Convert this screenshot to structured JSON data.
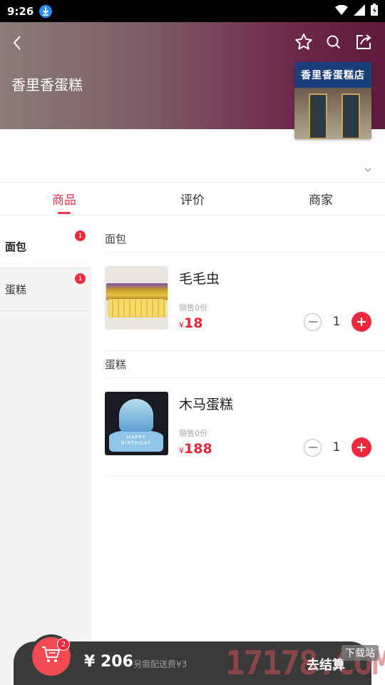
{
  "status_bar": {
    "time": "9:26"
  },
  "header": {
    "shop_name": "香里香蛋糕",
    "photo_sign": "香里香蛋糕店"
  },
  "tabs": [
    {
      "label": "商品",
      "active": true
    },
    {
      "label": "评价",
      "active": false
    },
    {
      "label": "商家",
      "active": false
    }
  ],
  "categories": [
    {
      "label": "面包",
      "badge": "1",
      "active": true
    },
    {
      "label": "蛋糕",
      "badge": "1",
      "active": false
    }
  ],
  "sections": [
    {
      "title": "面包",
      "product": {
        "name": "毛毛虫",
        "sales": "销售0份",
        "currency": "¥",
        "price": "18",
        "quantity": "1"
      }
    },
    {
      "title": "蛋糕",
      "product": {
        "name": "木马蛋糕",
        "sales": "销售0份",
        "currency": "¥",
        "price": "188",
        "quantity": "1",
        "image_text": "HAPPY BIRTHDAY"
      }
    }
  ],
  "cart": {
    "badge": "2",
    "total": "¥ 206",
    "delivery_note": "另需配送费¥3",
    "checkout_label": "去结算"
  },
  "watermark": {
    "text": "17178.COM",
    "badge": "下载站"
  },
  "colors": {
    "accent": "#e8334a",
    "cart_bar": "#3a3a3a",
    "cart_button": "#f04a54"
  }
}
